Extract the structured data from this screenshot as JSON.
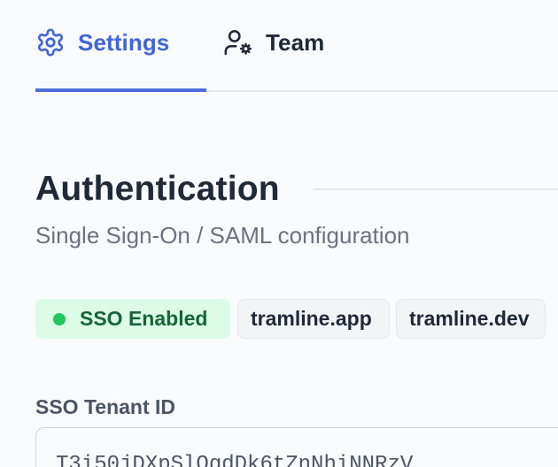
{
  "tabs": {
    "settings": {
      "label": "Settings",
      "icon": "gear-icon",
      "active": true
    },
    "team": {
      "label": "Team",
      "icon": "user-gear-icon",
      "active": false
    }
  },
  "section": {
    "title": "Authentication",
    "subtitle": "Single Sign-On / SAML configuration"
  },
  "badges": {
    "status": {
      "label": "SSO Enabled",
      "color": "#22c55e"
    },
    "domains": [
      "tramline.app",
      "tramline.dev"
    ]
  },
  "field": {
    "label": "SSO Tenant ID",
    "value": "T3i50jDXpSlQgdDk6tZnNhiNNRzV"
  },
  "colors": {
    "accent": "#4065d6",
    "success_bg": "#dcfce7",
    "success_text": "#166534"
  }
}
